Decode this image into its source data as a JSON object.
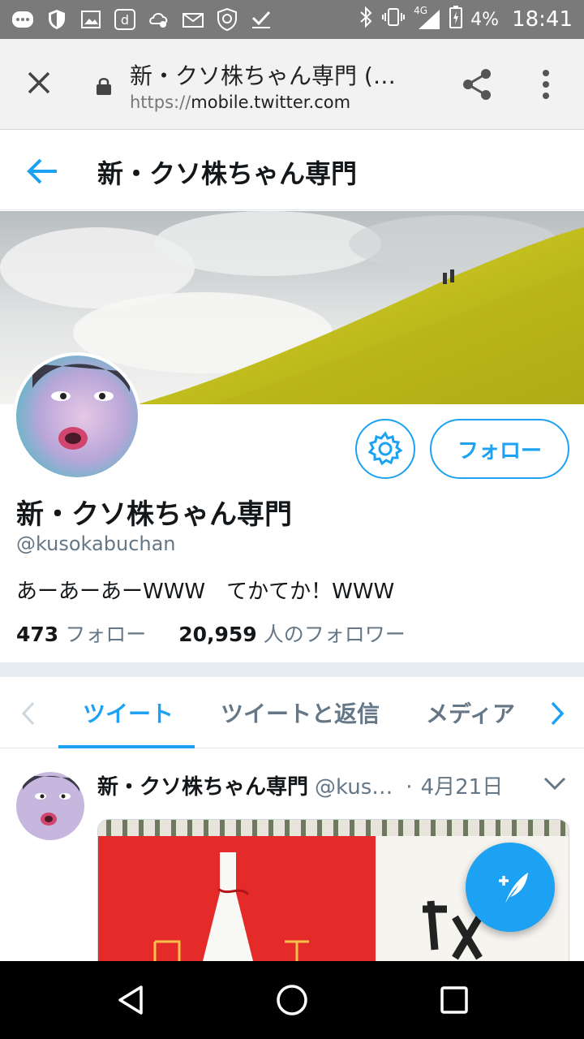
{
  "status_bar": {
    "network": "4G",
    "battery": "4%",
    "time": "18:41",
    "icons": [
      "more-icon",
      "shield-icon",
      "image-icon",
      "d-app-icon",
      "settings-cloud-icon",
      "sim-mail-icon",
      "vpn-shield-icon",
      "check-icon",
      "bluetooth-icon",
      "vibrate-icon",
      "signal-icon",
      "battery-charging-icon"
    ]
  },
  "browser": {
    "page_title": "新・クソ株ちゃん専門 (…",
    "url_proto": "https://",
    "url_host": "mobile.twitter.com"
  },
  "header": {
    "title": "新・クソ株ちゃん専門"
  },
  "profile": {
    "name": "新・クソ株ちゃん専門",
    "handle": "@kusokabuchan",
    "bio": "あーあーあーWWW　てかてか！WWW",
    "following_count": "473",
    "following_label": "フォロー",
    "followers_count": "20,959",
    "followers_label": "人のフォロワー",
    "follow_button": "フォロー"
  },
  "tabs": {
    "items": [
      {
        "label": "ツイート",
        "active": true
      },
      {
        "label": "ツイートと返信",
        "active": false
      },
      {
        "label": "メディア",
        "active": false
      }
    ]
  },
  "tweet": {
    "name": "新・クソ株ちゃん専門",
    "handle": "@kus…",
    "dot": "·",
    "date": "4月21日"
  },
  "colors": {
    "accent": "#1da1f2",
    "text": "#14171a",
    "muted": "#657786",
    "status_bar": "#7a7a7a"
  }
}
